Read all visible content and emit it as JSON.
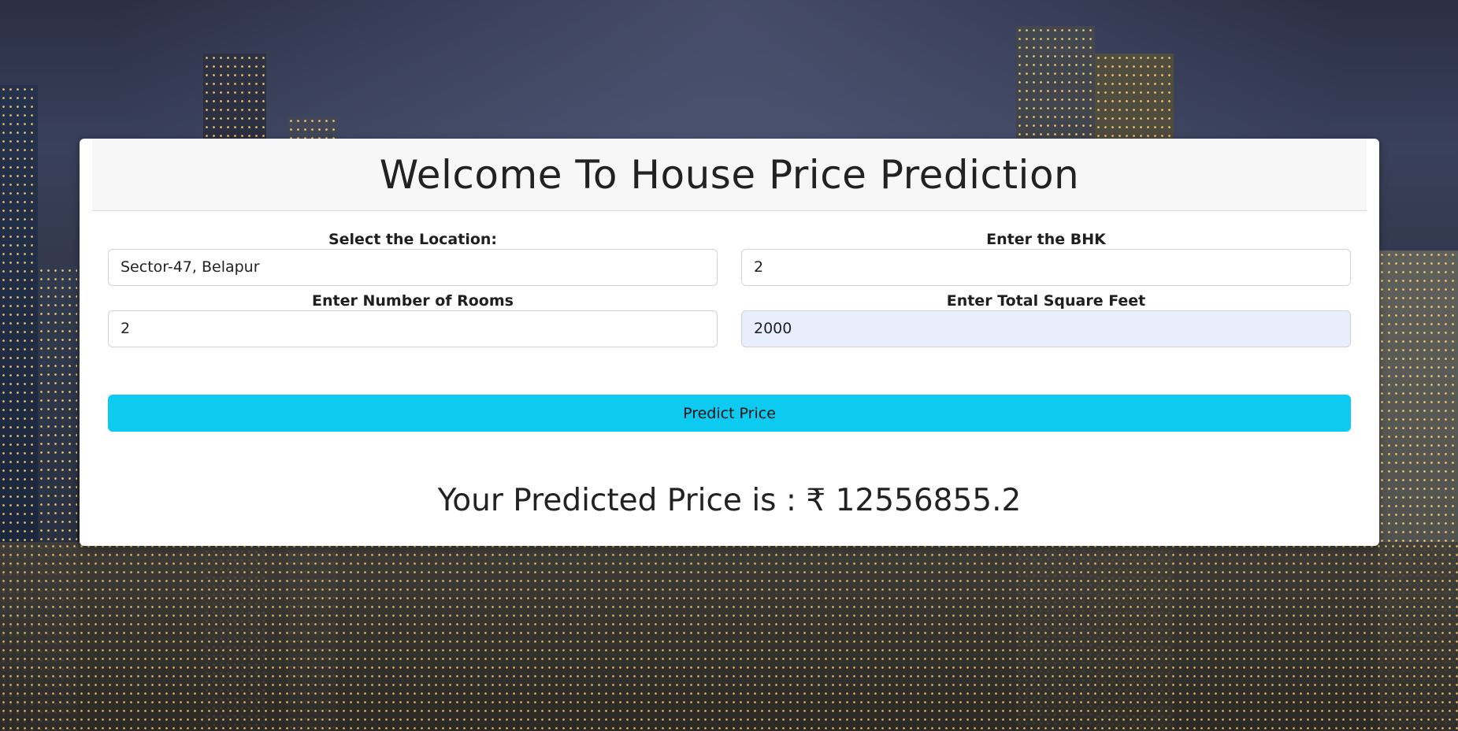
{
  "header": {
    "title": "Welcome To House Price Prediction"
  },
  "form": {
    "location": {
      "label": "Select the Location:",
      "value": "Sector-47, Belapur"
    },
    "bhk": {
      "label": "Enter the BHK",
      "value": "2"
    },
    "rooms": {
      "label": "Enter Number of Rooms",
      "value": "2"
    },
    "sqft": {
      "label": "Enter Total Square Feet",
      "value": "2000"
    }
  },
  "actions": {
    "predict_label": "Predict Price"
  },
  "result": {
    "text": "Your Predicted Price is : ₹ 12556855.2"
  },
  "colors": {
    "button": "#0dcaf0",
    "autofill_bg": "#e8eefb"
  }
}
